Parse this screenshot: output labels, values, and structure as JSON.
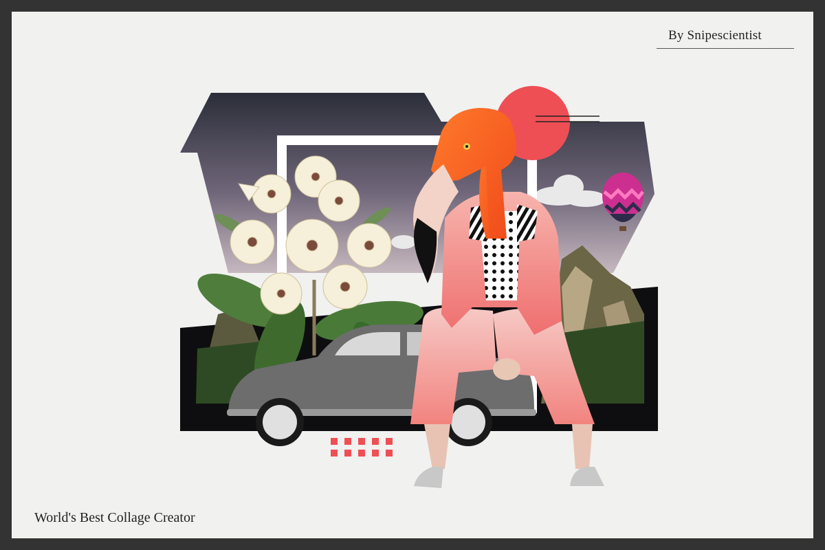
{
  "credit": "By Snipescientist",
  "caption": "World's Best Collage Creator",
  "colors": {
    "background": "#f1f1f0",
    "frame": "#333333",
    "accent_red": "#ee4f55",
    "sky_top": "#2c2f3a",
    "sky_bottom": "#b7a9b3",
    "suit_pink": "#f08a86",
    "flamingo": "#ff5a1f"
  },
  "icons": [
    "flamingo-head",
    "hot-air-balloon",
    "flower-cluster",
    "vintage-car",
    "red-circle",
    "mountain"
  ]
}
